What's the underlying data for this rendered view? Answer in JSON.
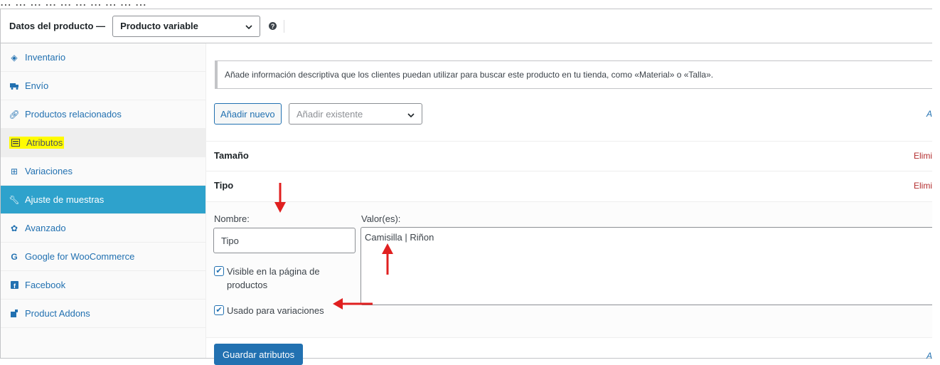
{
  "top_clip": "  ... ... ...  ... ... ...  ... ...  ... ...",
  "header": {
    "title": "Datos del producto —",
    "product_type": "Producto variable",
    "help_icon": "help-icon"
  },
  "sidebar": {
    "items": [
      {
        "label": "Inventario",
        "icon": "tag-icon"
      },
      {
        "label": "Envío",
        "icon": "truck-icon"
      },
      {
        "label": "Productos relacionados",
        "icon": "link-icon"
      },
      {
        "label": "Atributos",
        "icon": "list-icon"
      },
      {
        "label": "Variaciones",
        "icon": "grid-icon"
      },
      {
        "label": "Ajuste de muestras",
        "icon": "wrench-icon"
      },
      {
        "label": "Avanzado",
        "icon": "gear-icon"
      },
      {
        "label": "Google for WooCommerce",
        "icon": "google-icon"
      },
      {
        "label": "Facebook",
        "icon": "facebook-icon"
      },
      {
        "label": "Product Addons",
        "icon": "addon-icon"
      }
    ]
  },
  "main": {
    "notice": "Añade información descriptiva que los clientes puedan utilizar para buscar este producto en tu tienda, como «Material» o «Talla».",
    "add_new_label": "Añadir nuevo",
    "add_existing_placeholder": "Añadir existente",
    "expand_link": "A",
    "attributes": [
      {
        "name": "Tamaño",
        "remove_label": "Elimi"
      },
      {
        "name": "Tipo",
        "remove_label": "Elimi"
      }
    ],
    "edit": {
      "name_label": "Nombre:",
      "name_value": "Tipo",
      "values_label": "Valor(es):",
      "values_value": "Camisilla | Riñon",
      "visible_line1": "Visible en la página de",
      "visible_line2": "productos",
      "visible_checked": true,
      "used_label": "Usado para variaciones",
      "used_checked": true
    },
    "save_label": "Guardar atributos",
    "footer_link": "A"
  },
  "colors": {
    "accent": "#2271b1",
    "active_tab": "#2ea2cc",
    "highlight": "#fffb00",
    "danger": "#b32d2e",
    "annotation_arrow": "#e02020"
  }
}
